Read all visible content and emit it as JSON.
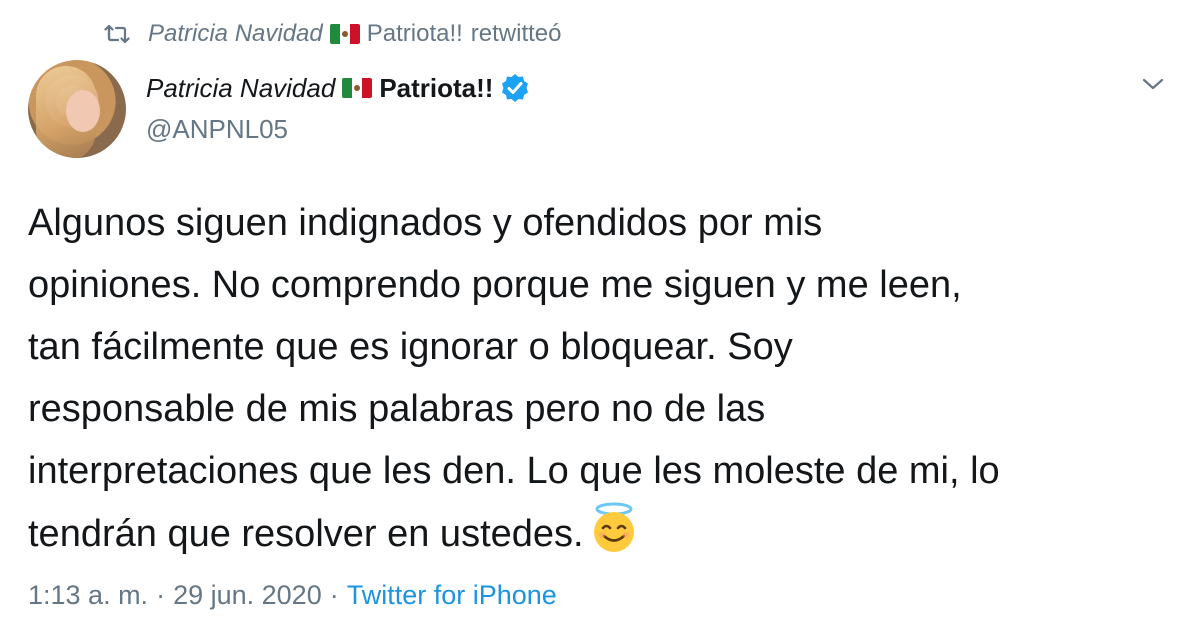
{
  "retweet_banner": {
    "icon": "retweet-icon",
    "name": "Patricia Navidad",
    "flag": "mexico-flag",
    "suffix_name": "Patriota!!",
    "action": "retwitteó"
  },
  "author": {
    "display_name": "Patricia Navidad",
    "flag": "mexico-flag",
    "name_suffix": "Patriota!!",
    "verified_icon": "verified-badge-icon",
    "handle": "@ANPNL05",
    "avatar": "profile-avatar"
  },
  "menu": {
    "icon": "chevron-down-icon"
  },
  "tweet": {
    "text": "Algunos siguen indignados y ofendidos por mis\nopiniones. No comprendo porque me siguen y me leen,\ntan fácilmente que es ignorar o bloquear. Soy\nresponsable de mis palabras pero no de las\ninterpretaciones que les den. Lo que les moleste de mi, lo\ntendrán que resolver en ustedes.",
    "emoji": "smiling-face-with-halo-icon"
  },
  "meta": {
    "time": "1:13 a. m.",
    "separator": "·",
    "date": "29 jun. 2020",
    "client": "Twitter for iPhone"
  },
  "colors": {
    "text": "#14171a",
    "muted": "#657786",
    "link": "#1b95e0",
    "verified": "#1da1f2"
  }
}
